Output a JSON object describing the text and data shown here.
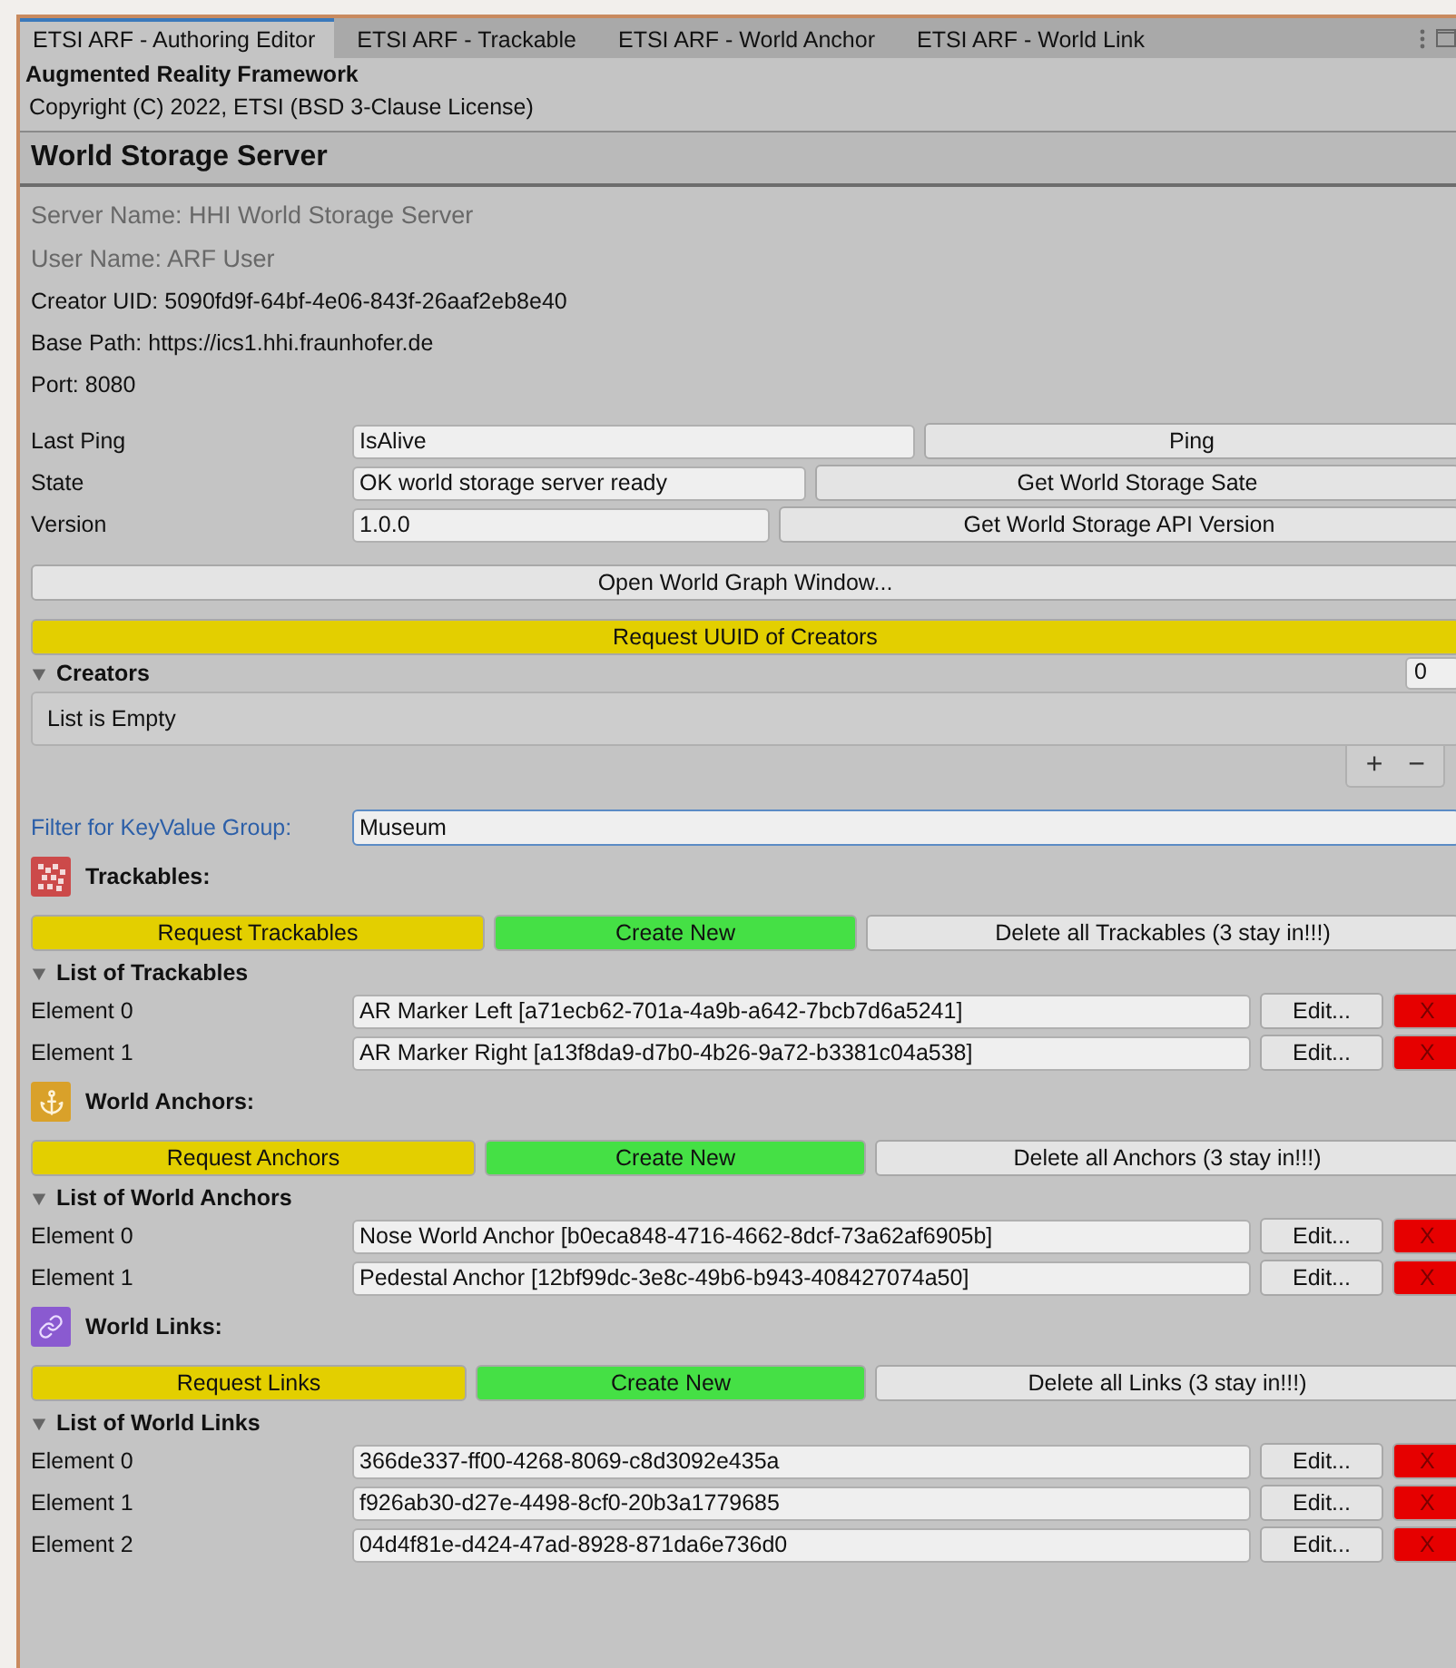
{
  "tabs": [
    {
      "label": "ETSI ARF - Authoring Editor",
      "selected": true
    },
    {
      "label": "ETSI ARF - Trackable",
      "selected": false
    },
    {
      "label": "ETSI ARF - World Anchor",
      "selected": false
    },
    {
      "label": "ETSI ARF - World Link",
      "selected": false
    }
  ],
  "header": {
    "title": "Augmented Reality Framework",
    "copyright": "Copyright (C) 2022, ETSI (BSD 3-Clause License)"
  },
  "section_title": "World Storage Server",
  "info": [
    {
      "text": "Server Name: HHI World Storage Server",
      "disabled": true
    },
    {
      "text": "User Name: ARF User",
      "disabled": true
    },
    {
      "text": "Creator UID: 5090fd9f-64bf-4e06-843f-26aaf2eb8e40",
      "disabled": false
    },
    {
      "text": "Base Path: https://ics1.hhi.fraunhofer.de",
      "disabled": false
    },
    {
      "text": "Port: 8080",
      "disabled": false
    }
  ],
  "status_rows": [
    {
      "label": "Last Ping",
      "value": "IsAlive",
      "button": "Ping"
    },
    {
      "label": "State",
      "value": "OK world storage server ready",
      "button": "Get World Storage Sate"
    },
    {
      "label": "Version",
      "value": "1.0.0",
      "button": "Get World Storage API Version"
    }
  ],
  "open_graph_button": "Open World Graph Window...",
  "request_creators_button": "Request UUID of Creators",
  "creators": {
    "title": "Creators",
    "expanded": true,
    "count": "0",
    "empty_text": "List is Empty",
    "add": "+",
    "remove": "−"
  },
  "filter": {
    "label": "Filter for KeyValue Group:",
    "value": "Museum"
  },
  "groups": [
    {
      "kind": "trackable",
      "title": "Trackables:",
      "request": "Request Trackables",
      "create": "Create New",
      "delete": "Delete all Trackables (3 stay in!!!)",
      "list_title": "List of Trackables",
      "expanded": true,
      "elements": [
        {
          "label": "Element 0",
          "value": "AR Marker Left [a71ecb62-701a-4a9b-a642-7bcb7d6a5241]",
          "edit": "Edit...",
          "remove": "X"
        },
        {
          "label": "Element 1",
          "value": "AR Marker Right [a13f8da9-d7b0-4b26-9a72-b3381c04a538]",
          "edit": "Edit...",
          "remove": "X"
        }
      ]
    },
    {
      "kind": "anchor",
      "title": "World Anchors:",
      "request": "Request Anchors",
      "create": "Create New",
      "delete": "Delete all Anchors (3 stay in!!!)",
      "list_title": "List of World Anchors",
      "expanded": true,
      "elements": [
        {
          "label": "Element 0",
          "value": "Nose World Anchor [b0eca848-4716-4662-8dcf-73a62af6905b]",
          "edit": "Edit...",
          "remove": "X"
        },
        {
          "label": "Element 1",
          "value": "Pedestal Anchor [12bf99dc-3e8c-49b6-b943-408427074a50]",
          "edit": "Edit...",
          "remove": "X"
        }
      ]
    },
    {
      "kind": "link",
      "title": "World Links:",
      "request": "Request Links",
      "create": "Create New",
      "delete": "Delete all Links (3 stay in!!!)",
      "list_title": "List of World Links",
      "expanded": true,
      "elements": [
        {
          "label": "Element 0",
          "value": "366de337-ff00-4268-8069-c8d3092e435a",
          "edit": "Edit...",
          "remove": "X"
        },
        {
          "label": "Element 1",
          "value": "f926ab30-d27e-4498-8cf0-20b3a1779685",
          "edit": "Edit...",
          "remove": "X"
        },
        {
          "label": "Element 2",
          "value": "04d4f81e-d424-47ad-8928-871da6e736d0",
          "edit": "Edit...",
          "remove": "X"
        }
      ]
    }
  ]
}
